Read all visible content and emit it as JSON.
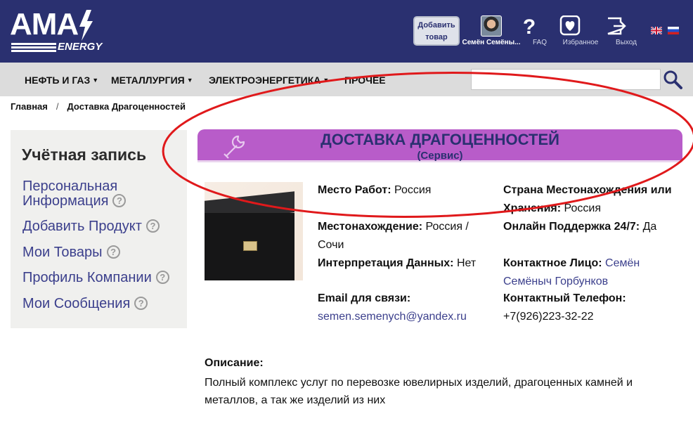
{
  "header": {
    "logo_text": "AMA",
    "logo_sub": "ENERGY",
    "add_button_label": "Добавить товар",
    "user_name": "Семён Семёны...",
    "faq_label": "FAQ",
    "favorites_label": "Избранное",
    "logout_label": "Выход",
    "icons": [
      "question-icon",
      "heart-icon",
      "logout-icon",
      "uk-flag-icon",
      "ru-flag-icon"
    ]
  },
  "nav": {
    "items": [
      {
        "label": "НЕФТЬ И ГАЗ"
      },
      {
        "label": "МЕТАЛЛУРГИЯ"
      },
      {
        "label": "ЭЛЕКТРОЭНЕРГЕТИКА"
      },
      {
        "label": "ПРОЧЕЕ"
      }
    ],
    "search_placeholder": ""
  },
  "breadcrumb": {
    "home": "Главная",
    "separator": "/",
    "current": "Доставка Драгоценностей"
  },
  "sidebar": {
    "title": "Учётная запись",
    "items": [
      {
        "label": "Персональная Информация"
      },
      {
        "label": "Добавить Продукт"
      },
      {
        "label": "Мои Товары"
      },
      {
        "label": "Профиль Компании"
      },
      {
        "label": "Мои Сообщения"
      }
    ],
    "help_glyph": "?"
  },
  "product": {
    "title": "ДОСТАВКА ДРАГОЦЕННОСТЕЙ",
    "subtitle": "(Сервис)",
    "fields": {
      "work_place_label": "Место Работ:",
      "work_place_value": "Россия",
      "location_label": "Местонахождение:",
      "location_value": "Россия / Сочи",
      "interpretation_label": "Интерпретация Данных:",
      "interpretation_value": "Нет",
      "email_label": "Email для связи:",
      "email_value": "semen.semenych@yandex.ru",
      "country_label": "Страна Местонахождения или Хранения:",
      "country_value": "Россия",
      "support_label": "Онлайн Поддержка 24/7:",
      "support_value": "Да",
      "contact_label": "Контактное Лицо:",
      "contact_value": "Семён Семёныч Горбунков",
      "phone_label": "Контактный Телефон:",
      "phone_value": "+7(926)223-32-22"
    },
    "description_title": "Описание:",
    "description_text": "Полный комплекс услуг по перевозке ювелирных изделий, драгоценных камней и металлов, а так же изделий из них"
  },
  "colors": {
    "header_bg": "#2a3070",
    "nav_bg": "#dcdcdc",
    "banner_bg": "#b85cc9",
    "link": "#3b3f8c",
    "annotation": "#e0191b"
  }
}
